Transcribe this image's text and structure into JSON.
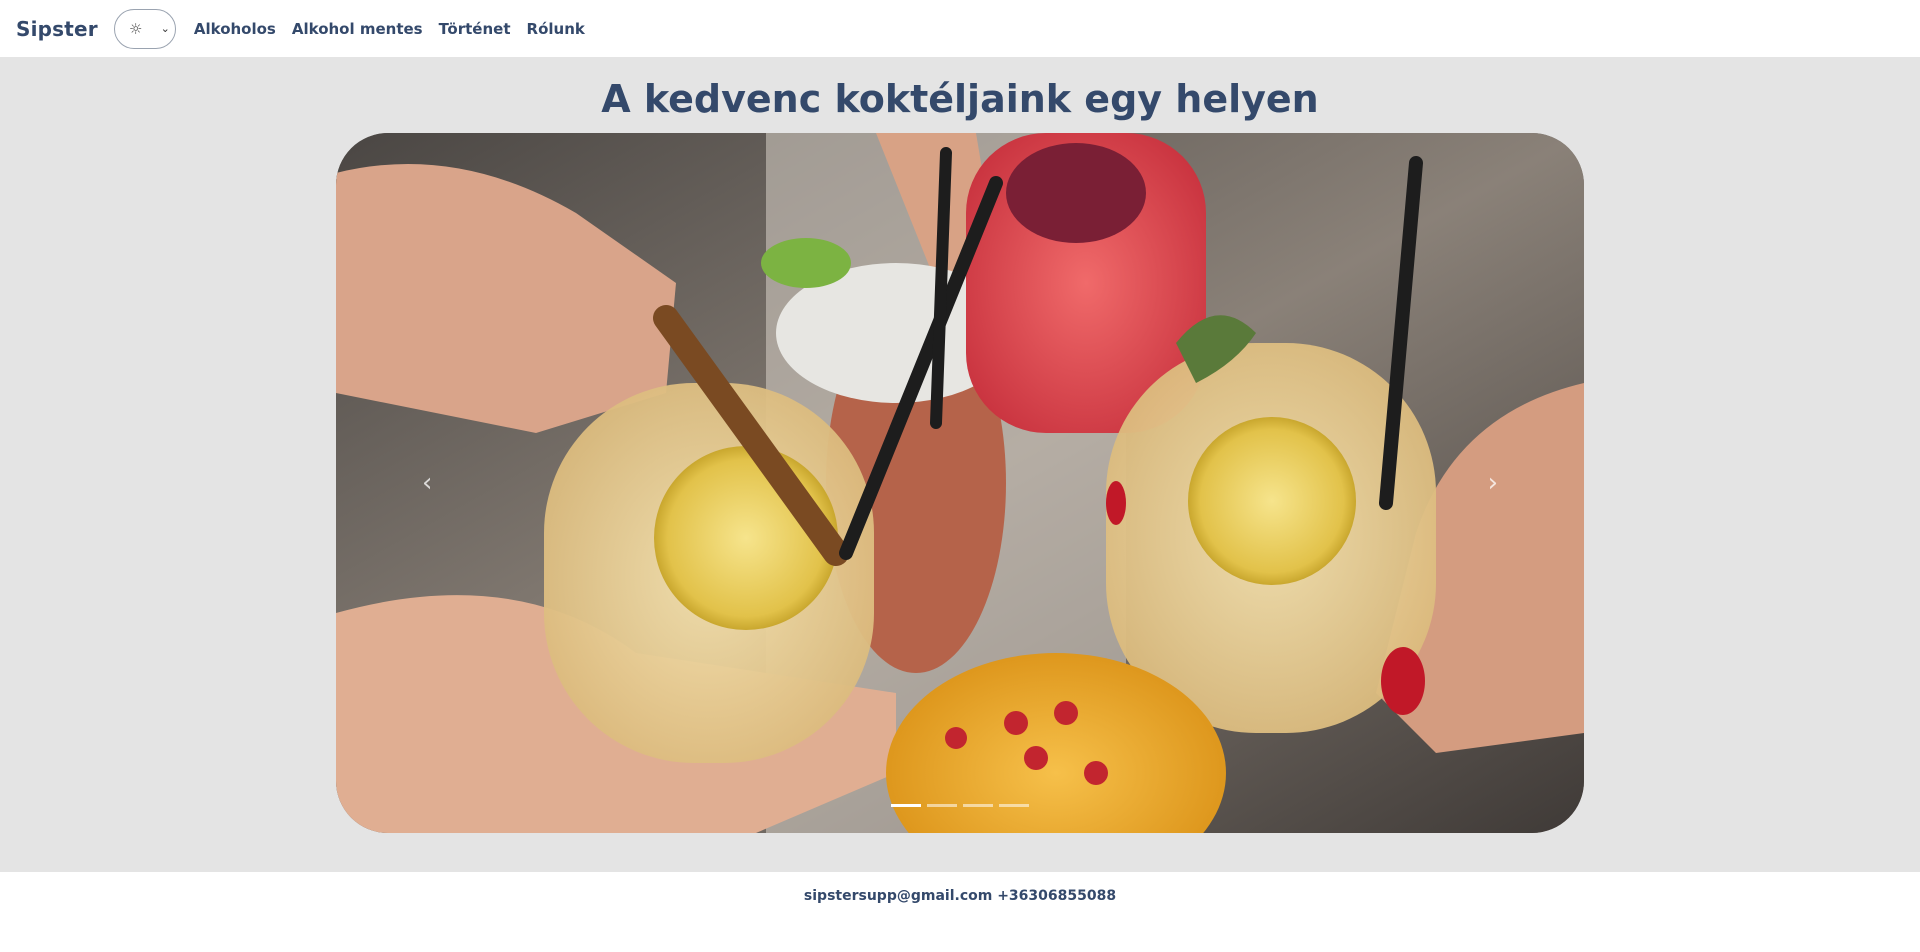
{
  "navbar": {
    "brand": "Sipster",
    "theme_icon": "☼",
    "links": [
      "Alkoholos",
      "Alkohol mentes",
      "Történet",
      "Rólunk"
    ]
  },
  "main": {
    "title": "A kedvenc koktéljaink egy helyen"
  },
  "carousel": {
    "image_description_icon": "cocktails-photo",
    "slide_count": 4,
    "active_slide": 1,
    "prev_icon": "‹",
    "next_icon": "›"
  },
  "footer": {
    "contact": "sipstersupp@gmail.com +36306855088"
  },
  "colors": {
    "brand": "#34496b",
    "background": "#e4e4e4"
  }
}
